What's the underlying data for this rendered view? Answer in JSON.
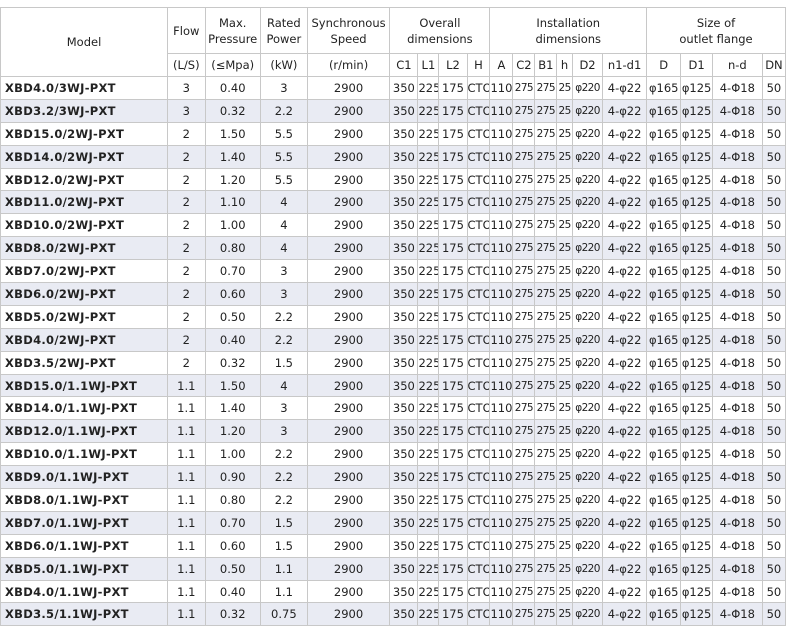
{
  "header": {
    "model": "Model",
    "flow": "Flow",
    "max_pressure_1": "Max.",
    "max_pressure_2": "Pressure",
    "rated_power_1": "Rated",
    "rated_power_2": "Power",
    "sync_speed_1": "Synchronous",
    "sync_speed_2": "Speed",
    "overall_1": "Overall",
    "overall_2": "dimensions",
    "install_1": "Installation",
    "install_2": "dimensions",
    "flange_1": "Size of",
    "flange_2": "outlet flange"
  },
  "units": {
    "flow": "(L/S)",
    "pressure": "(≤Mpa)",
    "power": "(kW)",
    "speed": "(r/min)"
  },
  "subheaders": [
    "C1",
    "L1",
    "L2",
    "H",
    "A",
    "C2",
    "B1",
    "h",
    "D2",
    "n1-d1",
    "D",
    "D1",
    "n-d",
    "DN"
  ],
  "rows": [
    [
      "XBD4.0/3WJ-PXT",
      "3",
      "0.40",
      "3",
      "2900",
      "350",
      "225",
      "175",
      "CTO",
      "110",
      "275",
      "275",
      "25",
      "φ220",
      "4-φ22",
      "φ165",
      "φ125",
      "4-Φ18",
      "50"
    ],
    [
      "XBD3.2/3WJ-PXT",
      "3",
      "0.32",
      "2.2",
      "2900",
      "350",
      "225",
      "175",
      "CTO",
      "110",
      "275",
      "275",
      "25",
      "φ220",
      "4-φ22",
      "φ165",
      "φ125",
      "4-Φ18",
      "50"
    ],
    [
      "XBD15.0/2WJ-PXT",
      "2",
      "1.50",
      "5.5",
      "2900",
      "350",
      "225",
      "175",
      "CTO",
      "110",
      "275",
      "275",
      "25",
      "φ220",
      "4-φ22",
      "φ165",
      "φ125",
      "4-Φ18",
      "50"
    ],
    [
      "XBD14.0/2WJ-PXT",
      "2",
      "1.40",
      "5.5",
      "2900",
      "350",
      "225",
      "175",
      "CTO",
      "110",
      "275",
      "275",
      "25",
      "φ220",
      "4-φ22",
      "φ165",
      "φ125",
      "4-Φ18",
      "50"
    ],
    [
      "XBD12.0/2WJ-PXT",
      "2",
      "1.20",
      "5.5",
      "2900",
      "350",
      "225",
      "175",
      "CTO",
      "110",
      "275",
      "275",
      "25",
      "φ220",
      "4-φ22",
      "φ165",
      "φ125",
      "4-Φ18",
      "50"
    ],
    [
      "XBD11.0/2WJ-PXT",
      "2",
      "1.10",
      "4",
      "2900",
      "350",
      "225",
      "175",
      "CTO",
      "110",
      "275",
      "275",
      "25",
      "φ220",
      "4-φ22",
      "φ165",
      "φ125",
      "4-Φ18",
      "50"
    ],
    [
      "XBD10.0/2WJ-PXT",
      "2",
      "1.00",
      "4",
      "2900",
      "350",
      "225",
      "175",
      "CTO",
      "110",
      "275",
      "275",
      "25",
      "φ220",
      "4-φ22",
      "φ165",
      "φ125",
      "4-Φ18",
      "50"
    ],
    [
      "XBD8.0/2WJ-PXT",
      "2",
      "0.80",
      "4",
      "2900",
      "350",
      "225",
      "175",
      "CTO",
      "110",
      "275",
      "275",
      "25",
      "φ220",
      "4-φ22",
      "φ165",
      "φ125",
      "4-Φ18",
      "50"
    ],
    [
      "XBD7.0/2WJ-PXT",
      "2",
      "0.70",
      "3",
      "2900",
      "350",
      "225",
      "175",
      "CTO",
      "110",
      "275",
      "275",
      "25",
      "φ220",
      "4-φ22",
      "φ165",
      "φ125",
      "4-Φ18",
      "50"
    ],
    [
      "XBD6.0/2WJ-PXT",
      "2",
      "0.60",
      "3",
      "2900",
      "350",
      "225",
      "175",
      "CTO",
      "110",
      "275",
      "275",
      "25",
      "φ220",
      "4-φ22",
      "φ165",
      "φ125",
      "4-Φ18",
      "50"
    ],
    [
      "XBD5.0/2WJ-PXT",
      "2",
      "0.50",
      "2.2",
      "2900",
      "350",
      "225",
      "175",
      "CTO",
      "110",
      "275",
      "275",
      "25",
      "φ220",
      "4-φ22",
      "φ165",
      "φ125",
      "4-Φ18",
      "50"
    ],
    [
      "XBD4.0/2WJ-PXT",
      "2",
      "0.40",
      "2.2",
      "2900",
      "350",
      "225",
      "175",
      "CTO",
      "110",
      "275",
      "275",
      "25",
      "φ220",
      "4-φ22",
      "φ165",
      "φ125",
      "4-Φ18",
      "50"
    ],
    [
      "XBD3.5/2WJ-PXT",
      "2",
      "0.32",
      "1.5",
      "2900",
      "350",
      "225",
      "175",
      "CTO",
      "110",
      "275",
      "275",
      "25",
      "φ220",
      "4-φ22",
      "φ165",
      "φ125",
      "4-Φ18",
      "50"
    ],
    [
      "XBD15.0/1.1WJ-PXT",
      "1.1",
      "1.50",
      "4",
      "2900",
      "350",
      "225",
      "175",
      "CTO",
      "110",
      "275",
      "275",
      "25",
      "φ220",
      "4-φ22",
      "φ165",
      "φ125",
      "4-Φ18",
      "50"
    ],
    [
      "XBD14.0/1.1WJ-PXT",
      "1.1",
      "1.40",
      "3",
      "2900",
      "350",
      "225",
      "175",
      "CTO",
      "110",
      "275",
      "275",
      "25",
      "φ220",
      "4-φ22",
      "φ165",
      "φ125",
      "4-Φ18",
      "50"
    ],
    [
      "XBD12.0/1.1WJ-PXT",
      "1.1",
      "1.20",
      "3",
      "2900",
      "350",
      "225",
      "175",
      "CTO",
      "110",
      "275",
      "275",
      "25",
      "φ220",
      "4-φ22",
      "φ165",
      "φ125",
      "4-Φ18",
      "50"
    ],
    [
      "XBD10.0/1.1WJ-PXT",
      "1.1",
      "1.00",
      "2.2",
      "2900",
      "350",
      "225",
      "175",
      "CTO",
      "110",
      "275",
      "275",
      "25",
      "φ220",
      "4-φ22",
      "φ165",
      "φ125",
      "4-Φ18",
      "50"
    ],
    [
      "XBD9.0/1.1WJ-PXT",
      "1.1",
      "0.90",
      "2.2",
      "2900",
      "350",
      "225",
      "175",
      "CTO",
      "110",
      "275",
      "275",
      "25",
      "φ220",
      "4-φ22",
      "φ165",
      "φ125",
      "4-Φ18",
      "50"
    ],
    [
      "XBD8.0/1.1WJ-PXT",
      "1.1",
      "0.80",
      "2.2",
      "2900",
      "350",
      "225",
      "175",
      "CTO",
      "110",
      "275",
      "275",
      "25",
      "φ220",
      "4-φ22",
      "φ165",
      "φ125",
      "4-Φ18",
      "50"
    ],
    [
      "XBD7.0/1.1WJ-PXT",
      "1.1",
      "0.70",
      "1.5",
      "2900",
      "350",
      "225",
      "175",
      "CTO",
      "110",
      "275",
      "275",
      "25",
      "φ220",
      "4-φ22",
      "φ165",
      "φ125",
      "4-Φ18",
      "50"
    ],
    [
      "XBD6.0/1.1WJ-PXT",
      "1.1",
      "0.60",
      "1.5",
      "2900",
      "350",
      "225",
      "175",
      "CTO",
      "110",
      "275",
      "275",
      "25",
      "φ220",
      "4-φ22",
      "φ165",
      "φ125",
      "4-Φ18",
      "50"
    ],
    [
      "XBD5.0/1.1WJ-PXT",
      "1.1",
      "0.50",
      "1.1",
      "2900",
      "350",
      "225",
      "175",
      "CTO",
      "110",
      "275",
      "275",
      "25",
      "φ220",
      "4-φ22",
      "φ165",
      "φ125",
      "4-Φ18",
      "50"
    ],
    [
      "XBD4.0/1.1WJ-PXT",
      "1.1",
      "0.40",
      "1.1",
      "2900",
      "350",
      "225",
      "175",
      "CTO",
      "110",
      "275",
      "275",
      "25",
      "φ220",
      "4-φ22",
      "φ165",
      "φ125",
      "4-Φ18",
      "50"
    ],
    [
      "XBD3.5/1.1WJ-PXT",
      "1.1",
      "0.32",
      "0.75",
      "2900",
      "350",
      "225",
      "175",
      "CTO",
      "110",
      "275",
      "275",
      "25",
      "φ220",
      "4-φ22",
      "φ165",
      "φ125",
      "4-Φ18",
      "50"
    ]
  ],
  "colors": {
    "stripe": "#e9ebf3",
    "border": "#c8c8c8",
    "text": "#222222"
  }
}
